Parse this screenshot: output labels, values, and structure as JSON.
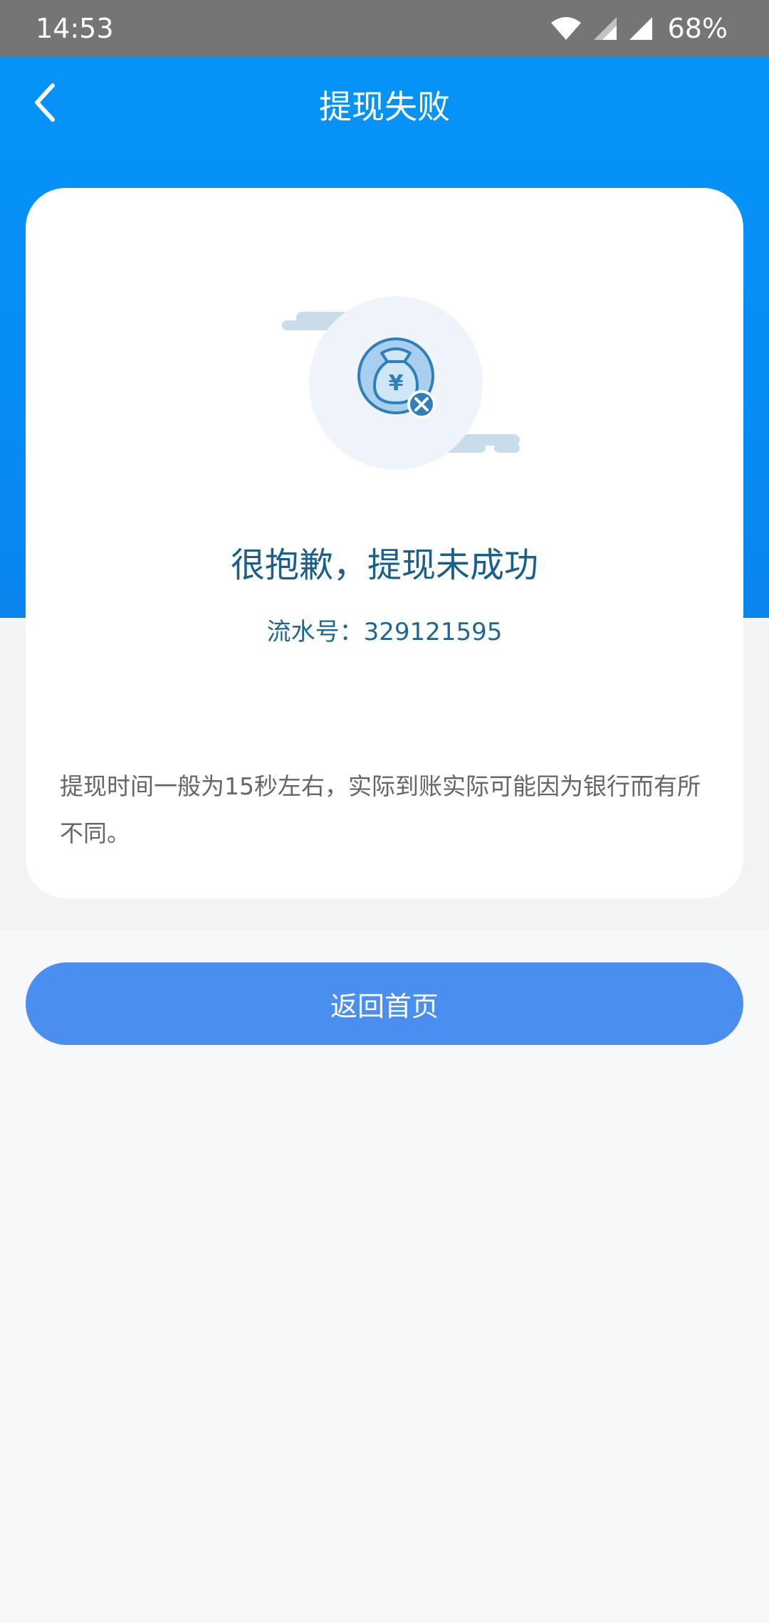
{
  "status_bar": {
    "time": "14:53",
    "battery": "68%",
    "icons": [
      "wifi-icon",
      "signal-icon",
      "signal-icon"
    ]
  },
  "nav": {
    "title": "提现失败",
    "back_icon": "chevron-left-icon"
  },
  "card": {
    "illustration_icon": "money-bag-failed-icon",
    "result_title": "很抱歉，提现未成功",
    "serial_label": "流水号：",
    "serial_number": "329121595",
    "notice": "提现时间一般为15秒左右，实际到账实际可能因为银行而有所不同。"
  },
  "actions": {
    "home_button": "返回首页"
  },
  "colors": {
    "header_blue": "#0793f9",
    "button_blue": "#4a8ff0",
    "title_text": "#1a5e8c"
  }
}
